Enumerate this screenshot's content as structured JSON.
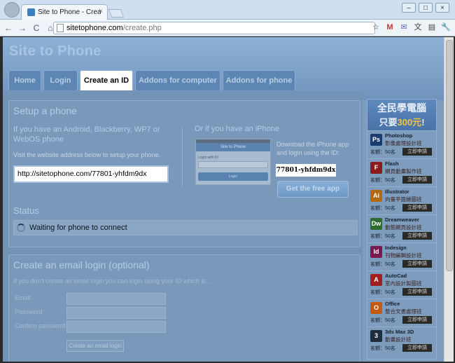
{
  "browser": {
    "tab_title": "Site to Phone - Create a S",
    "tab_close": "×",
    "win_min": "–",
    "win_max": "□",
    "win_close": "×",
    "back": "←",
    "forward": "→",
    "reload": "C",
    "home": "⌂",
    "url_host": "sitetophone.com",
    "url_path": "/create.php",
    "star": "☆",
    "ext_gmail": "M",
    "ext_mail": "✉",
    "ext_translate": "文",
    "ext_page": "▤",
    "ext_wrench": "🔧"
  },
  "site": {
    "title": "Site to Phone",
    "nav": [
      "Home",
      "Login",
      "Create an ID",
      "Addons for computer",
      "Addons for phone"
    ]
  },
  "setup": {
    "heading": "Setup a phone",
    "android_heading": "If you have an Android, Blackberry, WP7 or WebOS phone",
    "visit_text": "Visit the website address below to setup your phone.",
    "url_value": "http://sitetophone.com/77801-yhfdm9dx",
    "iphone_heading": "Or if you have an iPhone",
    "phone_mock": {
      "nav_title": "Site to Phone",
      "login_label": "Login with ID",
      "login_btn": "Login"
    },
    "download_text": "Download the iPhone app and login using the ID:",
    "id_value": "77801-yhfdm9dx",
    "free_app_button": "Get the free app"
  },
  "status": {
    "heading": "Status",
    "text": "Waiting for phone to connect"
  },
  "email": {
    "heading": "Create an email login (optional)",
    "description": "If you don't create an email login you can login using your ID which is...",
    "labels": [
      "Email",
      "Password",
      "Confirm password"
    ],
    "submit": "Create an email login"
  },
  "ad": {
    "banner_line1": "全民學電腦",
    "banner_line2_prefix": "只要",
    "banner_line2_num": "300元",
    "banner_line2_suffix": "!",
    "quota": "名額：50名",
    "apply": "立即申請",
    "items": [
      {
        "icon": "Ps",
        "name": "Photoshop",
        "sub": "影像處理設計班",
        "color": "#1b3c6e"
      },
      {
        "icon": "F",
        "name": "Flash",
        "sub": "網頁動畫製作班",
        "color": "#8a1c1c"
      },
      {
        "icon": "Ai",
        "name": "Illustrator",
        "sub": "向量平面繪圖班",
        "color": "#b26a10"
      },
      {
        "icon": "Dw",
        "name": "Dreamweaver",
        "sub": "動態網頁設計班",
        "color": "#2f6a2f"
      },
      {
        "icon": "Id",
        "name": "Indesign",
        "sub": "刊物編輯設計班",
        "color": "#7a1850"
      },
      {
        "icon": "A",
        "name": "AutoCad",
        "sub": "室內設計製圖班",
        "color": "#a02020"
      },
      {
        "icon": "O",
        "name": "Office",
        "sub": "整合文書處理班",
        "color": "#c45a12"
      },
      {
        "icon": "3",
        "name": "3ds Max 3D",
        "sub": "動畫設計班",
        "color": "#1e2e3e"
      }
    ]
  }
}
